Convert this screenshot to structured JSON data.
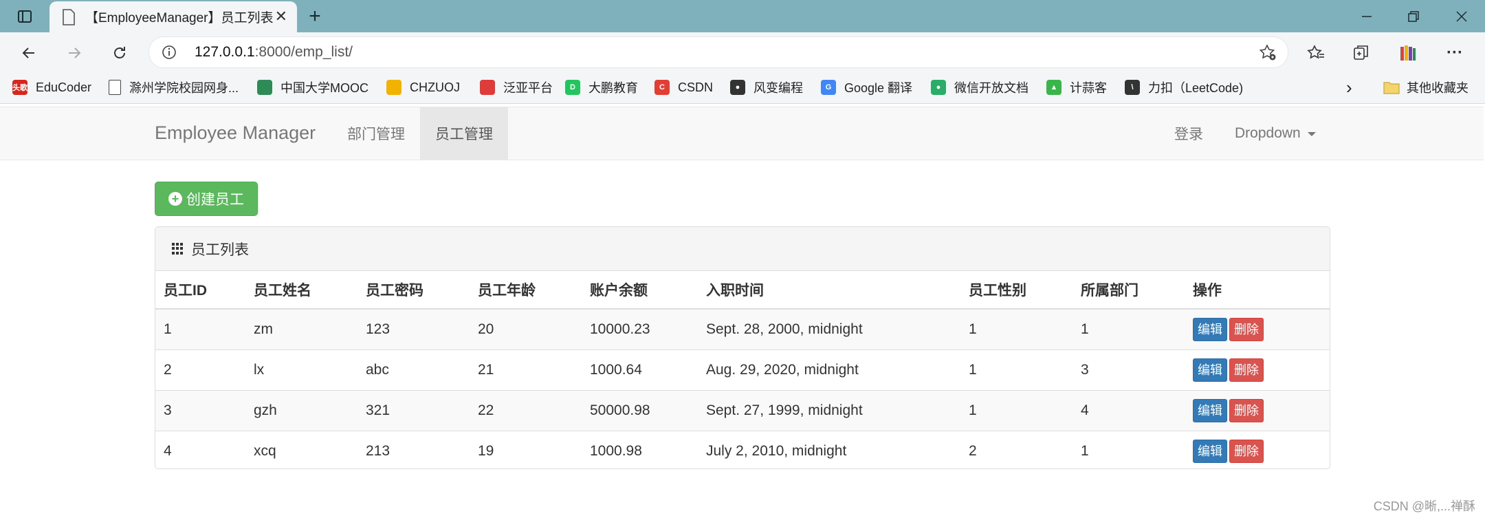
{
  "browser": {
    "tab_title": "【EmployeeManager】员工列表",
    "tab_close": "✕",
    "new_tab": "+",
    "url_host": "127.0.0.1",
    "url_rest": ":8000/emp_list/",
    "window_min": "—",
    "window_max": "❐",
    "window_close": "✕"
  },
  "bookmarks": [
    {
      "label": "EduCoder",
      "icon": "educoder-icon",
      "color": "#d9261c",
      "glyph": "头歌"
    },
    {
      "label": "滁州学院校园网身...",
      "icon": "document-icon",
      "color": "#ffffff",
      "glyph": ""
    },
    {
      "label": "中国大学MOOC",
      "icon": "mooc-icon",
      "color": "#2e8b57",
      "glyph": ""
    },
    {
      "label": "CHZUOJ",
      "icon": "chzuoj-icon",
      "color": "#f2b200",
      "glyph": ""
    },
    {
      "label": "泛亚平台",
      "icon": "fanya-icon",
      "color": "#e03b3b",
      "glyph": ""
    },
    {
      "label": "大鹏教育",
      "icon": "dapeng-icon",
      "color": "#22c55e",
      "glyph": "D"
    },
    {
      "label": "CSDN",
      "icon": "csdn-icon",
      "color": "#e33e33",
      "glyph": "C"
    },
    {
      "label": "风变编程",
      "icon": "panda-icon",
      "color": "#333333",
      "glyph": "●"
    },
    {
      "label": "Google 翻译",
      "icon": "google-translate-icon",
      "color": "#4285f4",
      "glyph": "G"
    },
    {
      "label": "微信开放文档",
      "icon": "wechat-icon",
      "color": "#2aae67",
      "glyph": "●"
    },
    {
      "label": "计蒜客",
      "icon": "jisuanke-icon",
      "color": "#39b54a",
      "glyph": "▲"
    },
    {
      "label": "力扣（LeetCode)",
      "icon": "leetcode-icon",
      "color": "#333333",
      "glyph": "\\"
    }
  ],
  "bookmarks_more": "›",
  "bookmarks_other": "其他收藏夹",
  "app": {
    "brand": "Employee Manager",
    "nav": [
      "部门管理",
      "员工管理"
    ],
    "login": "登录",
    "dropdown": "Dropdown",
    "create_button": "创建员工",
    "panel_title": "员工列表",
    "columns": [
      "员工ID",
      "员工姓名",
      "员工密码",
      "员工年龄",
      "账户余额",
      "入职时间",
      "员工性别",
      "所属部门",
      "操作"
    ],
    "rows": [
      [
        "1",
        "zm",
        "123",
        "20",
        "10000.23",
        "Sept. 28, 2000, midnight",
        "1",
        "1"
      ],
      [
        "2",
        "lx",
        "abc",
        "21",
        "1000.64",
        "Aug. 29, 2020, midnight",
        "1",
        "3"
      ],
      [
        "3",
        "gzh",
        "321",
        "22",
        "50000.98",
        "Sept. 27, 1999, midnight",
        "1",
        "4"
      ],
      [
        "4",
        "xcq",
        "213",
        "19",
        "1000.98",
        "July 2, 2010, midnight",
        "2",
        "1"
      ]
    ],
    "edit_label": "编辑",
    "delete_label": "删除"
  },
  "watermark": "CSDN @晰,...禅酥"
}
